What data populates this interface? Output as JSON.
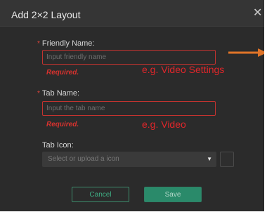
{
  "dialog": {
    "title": "Add 2×2 Layout",
    "close_glyph": "✕"
  },
  "form": {
    "friendly_name": {
      "required_marker": "*",
      "label": "Friendly Name:",
      "placeholder": "Input friendly name",
      "value": "",
      "error": "Required.",
      "hint": "e.g. Video Settings"
    },
    "tab_name": {
      "required_marker": "*",
      "label": "Tab Name:",
      "placeholder": "Input the tab name",
      "value": "",
      "error": "Required.",
      "hint": "e.g. Video"
    },
    "tab_icon": {
      "label": "Tab Icon:",
      "placeholder": "Select or upload a icon",
      "arrow_glyph": "▼"
    }
  },
  "buttons": {
    "cancel": "Cancel",
    "save": "Save"
  },
  "annotations": {
    "arrow_color": "#e07428",
    "hint_color": "#e0262a"
  },
  "colors": {
    "dialog_bg": "#2b2b2b",
    "header_bg": "#353535",
    "error_red": "#d9322e",
    "accent_green": "#2a8a6a"
  }
}
